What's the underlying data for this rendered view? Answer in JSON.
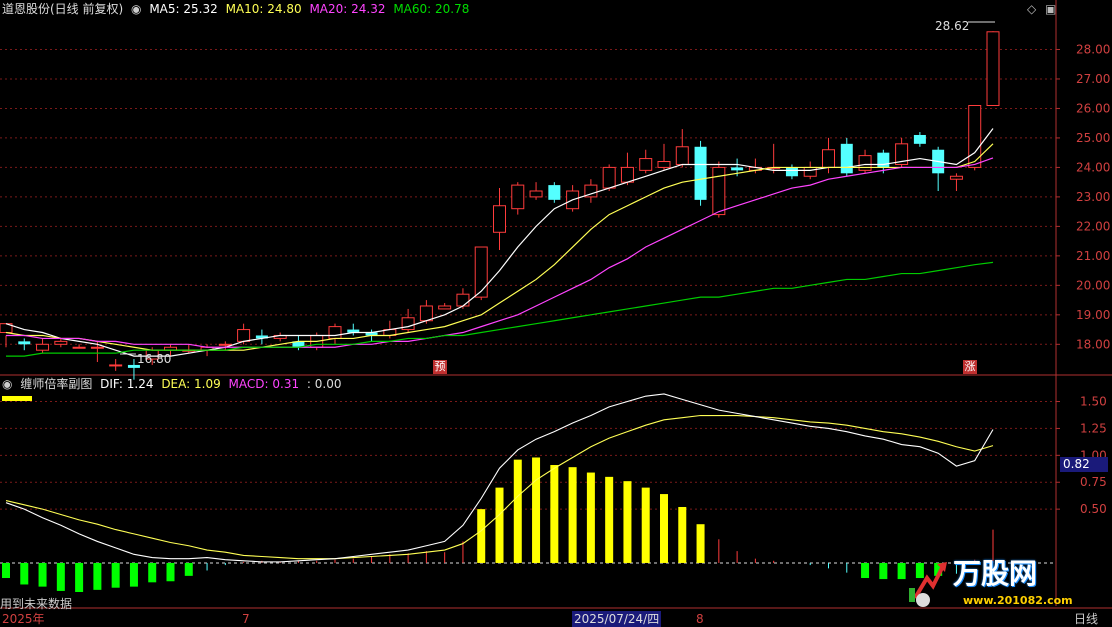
{
  "main_header": {
    "stock": "道恩股份(日线 前复权)",
    "ma5": "MA5: 25.32",
    "ma10": "MA10: 24.80",
    "ma20": "MA20: 24.32",
    "ma60": "MA60: 20.78"
  },
  "sub_header": {
    "name": "缠师倍率副图",
    "dif": "DIF: 1.24",
    "dea": "DEA: 1.09",
    "macd": "MACD: 0.31",
    "extra": ": 0.00"
  },
  "markers": {
    "yu": "预",
    "zhang": "涨"
  },
  "high_label": "28.62",
  "low_label": "16.80",
  "current_value": "0.82",
  "footer_note": "用到未来数据",
  "bottom_axis": {
    "year": "2025年",
    "jul": "7",
    "date": "2025/07/24/四",
    "aug": "8",
    "period": "日线"
  },
  "watermark_text": "万股网",
  "watermark_url": "www.201082.com",
  "chart_data": [
    {
      "type": "candlestick",
      "title": "道恩股份(日线 前复权)",
      "ylim": [
        17.4,
        29.0
      ],
      "y_ticks": [
        18,
        19,
        20,
        21,
        22,
        23,
        24,
        25,
        26,
        27,
        28
      ],
      "candles": [
        [
          18.4,
          18.7,
          17.9,
          18.3
        ],
        [
          18.1,
          18.0,
          18.2,
          17.8
        ],
        [
          17.8,
          18.0,
          18.2,
          17.7
        ],
        [
          18.0,
          18.1,
          18.2,
          17.9
        ],
        [
          17.9,
          17.9,
          18.0,
          17.9
        ],
        [
          17.9,
          17.9,
          18.1,
          17.4
        ],
        [
          17.3,
          17.3,
          17.5,
          17.1
        ],
        [
          17.3,
          17.2,
          17.5,
          16.8
        ],
        [
          17.5,
          17.8,
          17.9,
          17.3
        ],
        [
          17.8,
          17.9,
          18.0,
          17.6
        ],
        [
          17.8,
          17.8,
          18.0,
          17.7
        ],
        [
          17.8,
          17.9,
          18.0,
          17.6
        ],
        [
          18.0,
          18.0,
          18.1,
          17.8
        ],
        [
          18.1,
          18.5,
          18.7,
          18.0
        ],
        [
          18.3,
          18.2,
          18.5,
          18.0
        ],
        [
          18.2,
          18.3,
          18.4,
          18.1
        ],
        [
          18.1,
          17.9,
          18.3,
          17.8
        ],
        [
          17.9,
          18.3,
          18.4,
          17.8
        ],
        [
          18.2,
          18.6,
          18.7,
          18.0
        ],
        [
          18.5,
          18.4,
          18.7,
          18.3
        ],
        [
          18.4,
          18.3,
          18.5,
          18.1
        ],
        [
          18.3,
          18.5,
          18.8,
          18.2
        ],
        [
          18.5,
          18.9,
          19.2,
          18.4
        ],
        [
          18.8,
          19.3,
          19.5,
          18.7
        ],
        [
          19.2,
          19.3,
          19.4,
          19.2
        ],
        [
          19.3,
          19.7,
          19.9,
          19.2
        ],
        [
          19.6,
          21.3,
          21.3,
          19.5
        ],
        [
          21.8,
          22.7,
          23.3,
          21.2
        ],
        [
          22.6,
          23.4,
          23.5,
          22.4
        ],
        [
          23.0,
          23.2,
          23.5,
          22.9
        ],
        [
          23.4,
          22.9,
          23.5,
          22.8
        ],
        [
          22.6,
          23.2,
          23.4,
          22.5
        ],
        [
          23.0,
          23.4,
          23.6,
          22.8
        ],
        [
          23.3,
          24.0,
          24.1,
          23.2
        ],
        [
          23.5,
          24.0,
          24.5,
          23.4
        ],
        [
          23.9,
          24.3,
          24.6,
          23.8
        ],
        [
          24.0,
          24.2,
          24.8,
          23.9
        ],
        [
          24.1,
          24.7,
          25.3,
          24.0
        ],
        [
          24.7,
          22.9,
          24.9,
          22.7
        ],
        [
          22.4,
          24.0,
          24.2,
          22.3
        ],
        [
          24.0,
          23.9,
          24.3,
          23.7
        ],
        [
          23.9,
          24.0,
          24.3,
          23.8
        ],
        [
          24.0,
          24.0,
          24.8,
          23.8
        ],
        [
          24.0,
          23.7,
          24.1,
          23.6
        ],
        [
          23.7,
          24.0,
          24.2,
          23.6
        ],
        [
          24.0,
          24.6,
          25.0,
          23.8
        ],
        [
          24.8,
          23.8,
          25.0,
          23.7
        ],
        [
          23.9,
          24.4,
          24.6,
          23.8
        ],
        [
          24.5,
          24.0,
          24.6,
          23.8
        ],
        [
          24.1,
          24.8,
          25.0,
          24.0
        ],
        [
          25.1,
          24.8,
          25.2,
          24.7
        ],
        [
          24.6,
          23.8,
          24.7,
          23.2
        ],
        [
          23.6,
          23.7,
          23.8,
          23.2
        ],
        [
          24.0,
          26.1,
          26.1,
          23.9
        ],
        [
          26.1,
          28.6,
          28.62,
          26.1
        ]
      ],
      "ma": [
        {
          "name": "MA5",
          "color": "#ffffff",
          "values": [
            18.7,
            18.5,
            18.4,
            18.2,
            18.1,
            18.0,
            17.8,
            17.6,
            17.6,
            17.6,
            17.7,
            17.8,
            17.9,
            18.1,
            18.2,
            18.3,
            18.3,
            18.3,
            18.3,
            18.4,
            18.4,
            18.5,
            18.6,
            18.8,
            19.0,
            19.3,
            19.8,
            20.5,
            21.3,
            22.0,
            22.6,
            22.9,
            23.1,
            23.3,
            23.5,
            23.7,
            23.9,
            24.1,
            24.1,
            24.1,
            24.1,
            24.0,
            23.9,
            23.9,
            23.9,
            24.0,
            24.0,
            24.1,
            24.1,
            24.2,
            24.3,
            24.2,
            24.1,
            24.5,
            25.32
          ]
        },
        {
          "name": "MA10",
          "color": "#ffff55",
          "values": [
            18.4,
            18.3,
            18.3,
            18.2,
            18.2,
            18.1,
            18.0,
            17.9,
            17.8,
            17.8,
            17.8,
            17.8,
            17.8,
            17.8,
            17.9,
            18.0,
            18.1,
            18.1,
            18.2,
            18.2,
            18.3,
            18.3,
            18.4,
            18.5,
            18.6,
            18.8,
            19.0,
            19.4,
            19.8,
            20.2,
            20.7,
            21.3,
            21.9,
            22.4,
            22.7,
            23.0,
            23.3,
            23.5,
            23.6,
            23.7,
            23.8,
            23.9,
            24.0,
            24.0,
            24.0,
            24.0,
            24.0,
            24.0,
            24.0,
            24.0,
            24.0,
            24.0,
            24.0,
            24.2,
            24.8
          ]
        },
        {
          "name": "MA20",
          "color": "#ff44ff",
          "values": [
            18.3,
            18.3,
            18.2,
            18.2,
            18.2,
            18.1,
            18.1,
            18.0,
            18.0,
            18.0,
            18.0,
            17.9,
            17.9,
            17.9,
            17.9,
            17.9,
            17.9,
            17.9,
            17.9,
            18.0,
            18.0,
            18.1,
            18.1,
            18.2,
            18.3,
            18.4,
            18.6,
            18.8,
            19.0,
            19.3,
            19.6,
            19.9,
            20.2,
            20.6,
            20.9,
            21.3,
            21.6,
            21.9,
            22.2,
            22.5,
            22.7,
            22.9,
            23.1,
            23.3,
            23.4,
            23.6,
            23.7,
            23.8,
            23.9,
            24.0,
            24.0,
            24.0,
            24.0,
            24.1,
            24.32
          ]
        },
        {
          "name": "MA60",
          "color": "#00cc00",
          "values": [
            17.6,
            17.6,
            17.7,
            17.7,
            17.7,
            17.7,
            17.7,
            17.8,
            17.8,
            17.8,
            17.8,
            17.8,
            17.8,
            17.9,
            17.9,
            17.9,
            17.9,
            18.0,
            18.0,
            18.0,
            18.1,
            18.1,
            18.2,
            18.2,
            18.3,
            18.3,
            18.4,
            18.5,
            18.6,
            18.7,
            18.8,
            18.9,
            19.0,
            19.1,
            19.2,
            19.3,
            19.4,
            19.5,
            19.6,
            19.6,
            19.7,
            19.8,
            19.9,
            19.9,
            20.0,
            20.1,
            20.2,
            20.2,
            20.3,
            20.4,
            20.4,
            20.5,
            20.6,
            20.7,
            20.78
          ]
        }
      ]
    },
    {
      "type": "bar",
      "title": "缠师倍率副图",
      "ylim": [
        -0.4,
        1.7
      ],
      "y_ticks": [
        0.5,
        0.75,
        1.0,
        1.25,
        1.5
      ],
      "x": [
        0,
        1,
        2,
        3,
        4,
        5,
        6,
        7,
        8,
        9,
        10,
        11,
        12,
        13,
        14,
        15,
        16,
        17,
        18,
        19,
        20,
        21,
        22,
        23,
        24,
        25,
        26,
        27,
        28,
        29,
        30,
        31,
        32,
        33,
        34,
        35,
        36,
        37,
        38,
        39,
        40,
        41,
        42,
        43,
        44,
        45,
        46,
        47,
        48,
        49,
        50,
        51,
        52,
        53,
        54
      ],
      "macd": [
        -0.14,
        -0.2,
        -0.22,
        -0.26,
        -0.27,
        -0.25,
        -0.23,
        -0.22,
        -0.18,
        -0.17,
        -0.12,
        -0.07,
        -0.02,
        0.01,
        0.02,
        0.01,
        0.02,
        0.02,
        0.03,
        0.04,
        0.06,
        0.08,
        0.09,
        0.11,
        0.1,
        0.2,
        0.5,
        0.7,
        0.96,
        0.98,
        0.91,
        0.89,
        0.84,
        0.8,
        0.76,
        0.7,
        0.64,
        0.52,
        0.36,
        0.22,
        0.11,
        0.04,
        0.02,
        0.0,
        -0.02,
        -0.05,
        -0.09,
        -0.14,
        -0.15,
        -0.15,
        -0.14,
        -0.12,
        -0.1,
        0.03,
        0.31
      ],
      "dif": [
        0.56,
        0.5,
        0.42,
        0.35,
        0.27,
        0.2,
        0.14,
        0.08,
        0.05,
        0.04,
        0.04,
        0.05,
        0.03,
        0.02,
        0.01,
        0.01,
        0.02,
        0.03,
        0.04,
        0.06,
        0.08,
        0.1,
        0.12,
        0.16,
        0.2,
        0.35,
        0.6,
        0.88,
        1.05,
        1.15,
        1.22,
        1.3,
        1.37,
        1.45,
        1.5,
        1.55,
        1.57,
        1.52,
        1.47,
        1.42,
        1.39,
        1.36,
        1.33,
        1.3,
        1.27,
        1.25,
        1.22,
        1.18,
        1.15,
        1.1,
        1.08,
        1.02,
        0.9,
        0.95,
        1.24
      ],
      "dea": [
        0.58,
        0.54,
        0.5,
        0.45,
        0.4,
        0.36,
        0.31,
        0.27,
        0.23,
        0.19,
        0.16,
        0.12,
        0.1,
        0.07,
        0.06,
        0.05,
        0.04,
        0.04,
        0.04,
        0.05,
        0.06,
        0.07,
        0.08,
        0.1,
        0.12,
        0.18,
        0.3,
        0.45,
        0.62,
        0.77,
        0.88,
        0.98,
        1.08,
        1.16,
        1.22,
        1.28,
        1.33,
        1.35,
        1.37,
        1.37,
        1.37,
        1.36,
        1.35,
        1.33,
        1.31,
        1.3,
        1.28,
        1.25,
        1.22,
        1.2,
        1.17,
        1.13,
        1.08,
        1.04,
        1.09
      ]
    }
  ]
}
